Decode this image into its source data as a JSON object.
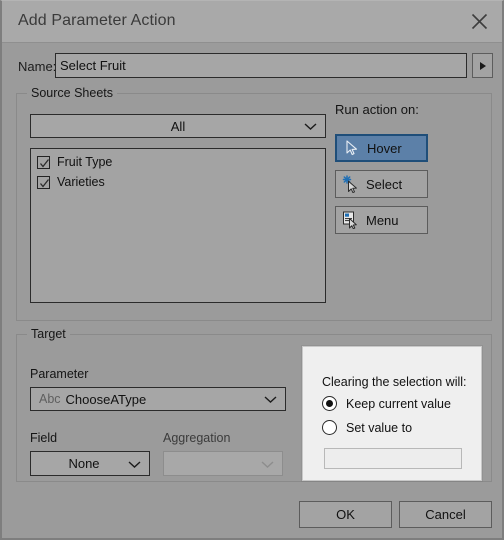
{
  "window": {
    "title": "Add Parameter Action",
    "close_icon": "close-icon"
  },
  "name_row": {
    "label": "Name:",
    "value": "Select Fruit",
    "placeholder": "",
    "arrow_icon": "triangle-right-icon"
  },
  "source_sheets": {
    "legend": "Source Sheets",
    "dropdown_value": "All",
    "dropdown_options": [
      "All"
    ],
    "items": [
      {
        "label": "Fruit Type",
        "checked": true
      },
      {
        "label": "Varieties",
        "checked": true
      }
    ]
  },
  "run_action": {
    "label": "Run action on:",
    "buttons": [
      {
        "label": "Hover",
        "icon": "hover-cursor-icon",
        "selected": true
      },
      {
        "label": "Select",
        "icon": "select-cursor-icon",
        "selected": false
      },
      {
        "label": "Menu",
        "icon": "menu-cursor-icon",
        "selected": false
      }
    ],
    "selected_color": "#5c80a8",
    "selected_border_color": "#1f4e79"
  },
  "target": {
    "legend": "Target",
    "parameter_label": "Parameter",
    "parameter_type_prefix": "Abc",
    "parameter_value": "ChooseAType",
    "field_label": "Field",
    "field_value": "None",
    "aggregation_label": "Aggregation",
    "aggregation_value": "",
    "aggregation_disabled": true
  },
  "clearing_panel": {
    "title": "Clearing the selection will:",
    "options": [
      {
        "label": "Keep current value",
        "selected": true
      },
      {
        "label": "Set value to",
        "selected": false
      }
    ],
    "set_value_input": "",
    "set_value_placeholder": ""
  },
  "footer": {
    "ok_label": "OK",
    "cancel_label": "Cancel"
  }
}
